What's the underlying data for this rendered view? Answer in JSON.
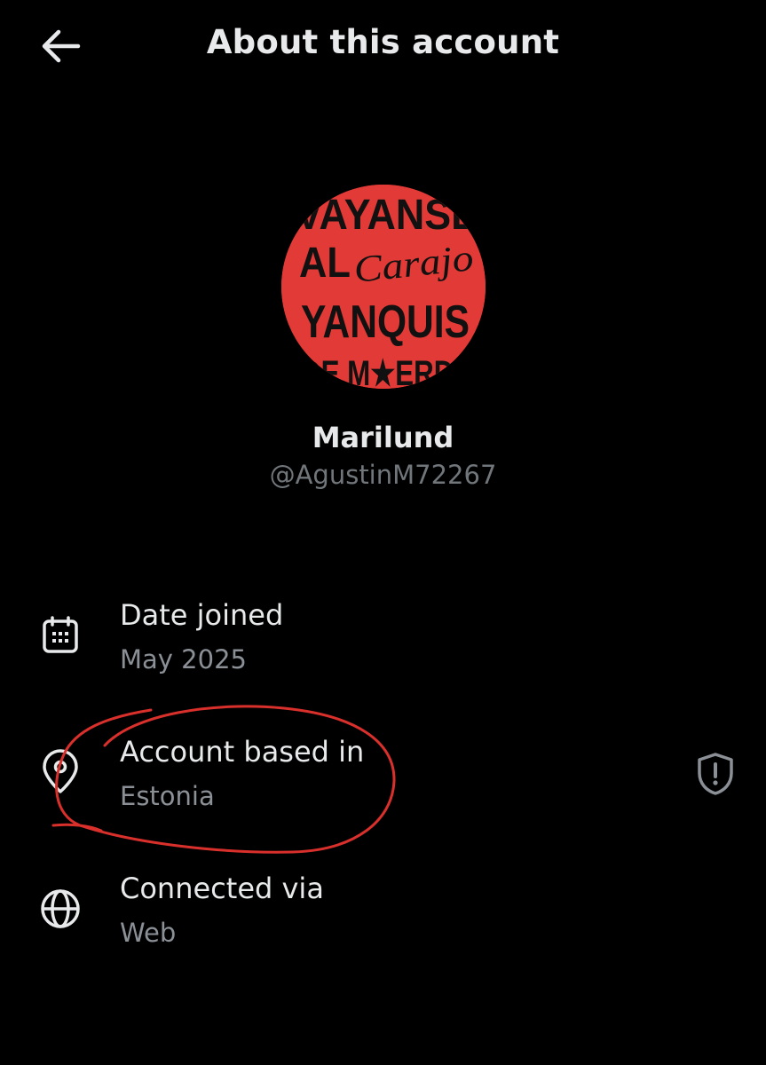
{
  "header": {
    "title": "About this account",
    "back_icon": "arrow-left-icon"
  },
  "profile": {
    "display_name": "Marilund",
    "handle": "@AgustinM72267",
    "avatar": {
      "background": "#e23a36",
      "lines": [
        "VAYANSE",
        "AL",
        "Carajo",
        "YANQUIS",
        "DE M★ERDA"
      ]
    }
  },
  "rows": [
    {
      "icon": "calendar-icon",
      "label": "Date joined",
      "value": "May 2025"
    },
    {
      "icon": "location-pin-icon",
      "label": "Account based in",
      "value": "Estonia",
      "trailing_icon": "shield-alert-icon"
    },
    {
      "icon": "globe-icon",
      "label": "Connected via",
      "value": "Web"
    }
  ],
  "colors": {
    "background": "#000000",
    "primary_text": "#e7e9ea",
    "secondary_text": "#71767b",
    "annotation": "#d9302c"
  }
}
